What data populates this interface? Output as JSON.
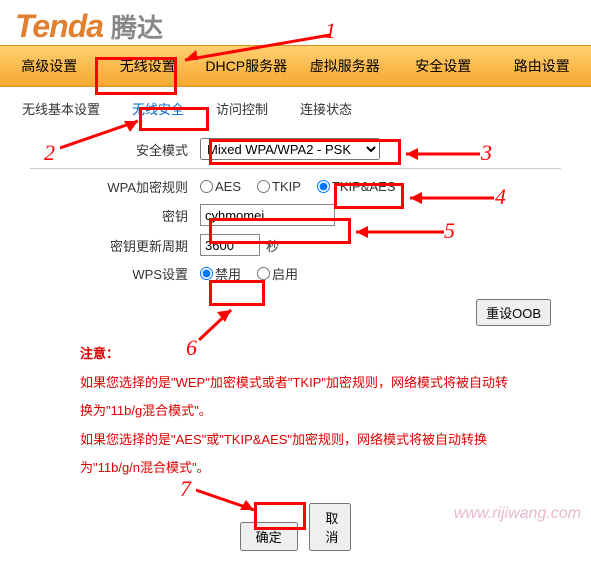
{
  "logo": {
    "text": "Tenda",
    "cn": "腾达"
  },
  "topnav": {
    "items": [
      "高级设置",
      "无线设置",
      "DHCP服务器",
      "虚拟服务器",
      "安全设置",
      "路由设置"
    ]
  },
  "subnav": {
    "items": [
      "无线基本设置",
      "无线安全",
      "访问控制",
      "连接状态"
    ]
  },
  "form": {
    "security_mode_label": "安全模式",
    "security_mode_value": "Mixed WPA/WPA2 - PSK",
    "wpa_rule_label": "WPA加密规则",
    "aes": "AES",
    "tkip": "TKIP",
    "tkipaes": "TKIP&AES",
    "key_label": "密钥",
    "key_value": "cyhmomei",
    "period_label": "密钥更新周期",
    "period_value": "3600",
    "period_unit": "秒",
    "wps_label": "WPS设置",
    "wps_disable": "禁用",
    "wps_enable": "启用",
    "reset_oob": "重设OOB"
  },
  "notice": {
    "title": "注意：",
    "p1": "如果您选择的是\"WEP\"加密模式或者\"TKIP\"加密规则，网络模式将被自动转换为\"11b/g混合模式\"。",
    "p2": "如果您选择的是\"AES\"或\"TKIP&AES\"加密规则，网络模式将被自动转换为\"11b/g/n混合模式\"。"
  },
  "buttons": {
    "ok": "确定",
    "cancel": "取消"
  },
  "watermark": "www.rijiwang.com",
  "annotations": {
    "n1": "1",
    "n2": "2",
    "n3": "3",
    "n4": "4",
    "n5": "5",
    "n6": "6",
    "n7": "7"
  }
}
